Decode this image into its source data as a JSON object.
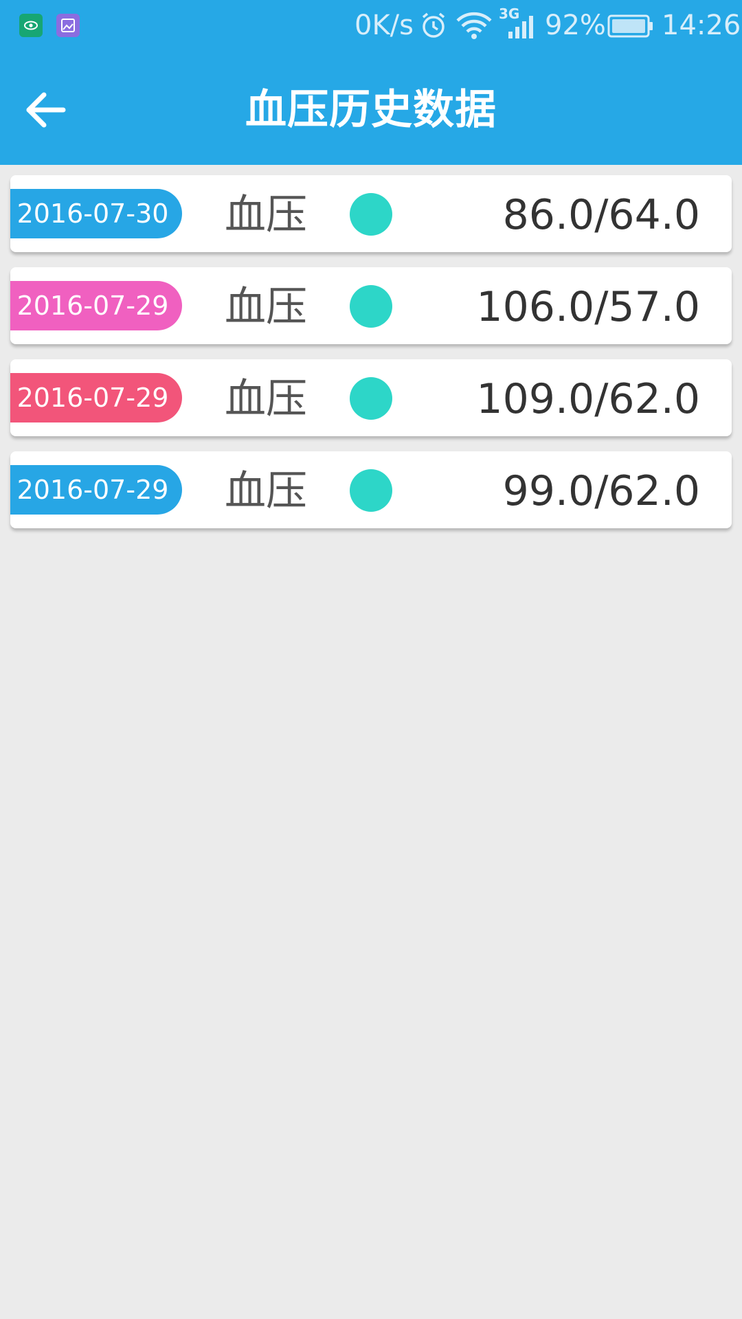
{
  "status_bar": {
    "network_speed": "0K/s",
    "network_type": "3G",
    "battery_percent": "92%",
    "time": "14:26",
    "icons": [
      "eye-app-icon",
      "gallery-app-icon",
      "alarm-icon",
      "wifi-icon",
      "cell-signal-icon",
      "battery-icon"
    ]
  },
  "header": {
    "title": "血压历史数据",
    "back_icon": "arrow-left-icon"
  },
  "colors": {
    "header_bg": "#26a8e6",
    "page_bg": "#ebebeb",
    "dot": "#2dd6c8",
    "date_blue": "#27a6e5",
    "date_pink": "#f060c0",
    "date_red": "#f2557a"
  },
  "records": [
    {
      "date": "2016-07-30",
      "label": "血压",
      "value": "86.0/64.0",
      "date_color": "#27a6e5",
      "dot_color": "#2dd6c8"
    },
    {
      "date": "2016-07-29",
      "label": "血压",
      "value": "106.0/57.0",
      "date_color": "#f060c0",
      "dot_color": "#2dd6c8"
    },
    {
      "date": "2016-07-29",
      "label": "血压",
      "value": "109.0/62.0",
      "date_color": "#f2557a",
      "dot_color": "#2dd6c8"
    },
    {
      "date": "2016-07-29",
      "label": "血压",
      "value": "99.0/62.0",
      "date_color": "#27a6e5",
      "dot_color": "#2dd6c8"
    }
  ]
}
